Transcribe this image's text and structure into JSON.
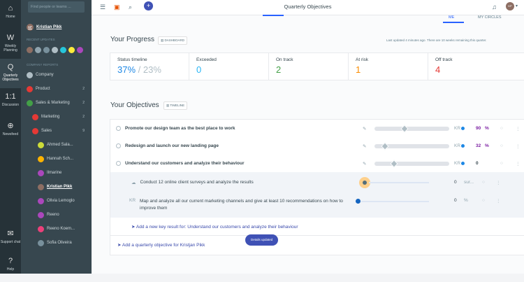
{
  "rail": [
    {
      "icon": "⌂",
      "label": "Home",
      "name": "home"
    },
    {
      "icon": "W",
      "label": "Weekly Planning",
      "name": "weekly-planning"
    },
    {
      "icon": "Q",
      "label": "Quarterly Objectives",
      "name": "quarterly-objectives"
    },
    {
      "icon": "1:1",
      "label": "Discussion",
      "name": "discussion"
    },
    {
      "icon": "⊕",
      "label": "Newsfeed",
      "name": "newsfeed"
    },
    {
      "icon": "✉",
      "label": "Support chat",
      "name": "support-chat"
    },
    {
      "icon": "?",
      "label": "Help",
      "name": "help"
    }
  ],
  "sidebar": {
    "search_placeholder": "Find people or teams ...",
    "user": {
      "initials": "KP",
      "name": "Kristian Pikk"
    },
    "recent_label": "RECENT UPDATES",
    "company_label": "COMPANY REPORTS",
    "tree": [
      {
        "label": "Company",
        "count": "",
        "indent": 8,
        "color": "#b0bec5"
      },
      {
        "label": "Product",
        "count": "2",
        "indent": 8,
        "color": "#e53935"
      },
      {
        "label": "Sales & Marketing",
        "count": "2",
        "indent": 8,
        "color": "#43a047"
      },
      {
        "label": "Marketing",
        "count": "2",
        "indent": 16,
        "color": "#e53935"
      },
      {
        "label": "Sales",
        "count": "9",
        "indent": 16,
        "color": "#e53935"
      },
      {
        "label": "Ahmed Sala...",
        "count": "",
        "indent": 24,
        "color": "#cddc39"
      },
      {
        "label": "Hannah Sch...",
        "count": "",
        "indent": 24,
        "color": "#ffb300"
      },
      {
        "label": "Ilmarine",
        "count": "",
        "indent": 24,
        "color": "#ab47bc"
      },
      {
        "label": "Kristian Pikk",
        "count": "",
        "indent": 24,
        "color": "#8d6e63",
        "selected": true
      },
      {
        "label": "Olivia Lemoglo",
        "count": "",
        "indent": 24,
        "color": "#ab47bc"
      },
      {
        "label": "Reeno",
        "count": "",
        "indent": 24,
        "color": "#ab47bc"
      },
      {
        "label": "Reeno Koem...",
        "count": "",
        "indent": 24,
        "color": "#ec407a"
      },
      {
        "label": "Sofia Oliveira",
        "count": "",
        "indent": 24,
        "color": "#78909c"
      }
    ]
  },
  "topbar": {
    "title": "Quarterly Objectives",
    "me_tab": "ME",
    "circles_tab": "MY CIRCLES",
    "avatar": "KP"
  },
  "progress": {
    "title": "Your Progress",
    "dashboard": "DASHBOARD",
    "updated": "Last updated 4 minutes ago. There are 10 weeks remaining this quarter.",
    "status_label": "Status timeline",
    "status_value": "37%",
    "status_sep": " / ",
    "status_target": "23%",
    "exceeded_label": "Exceeded",
    "exceeded_value": "0",
    "ontrack_label": "On track",
    "ontrack_value": "2",
    "atrisk_label": "At risk",
    "atrisk_value": "1",
    "offtrack_label": "Off track",
    "offtrack_value": "4"
  },
  "objectives": {
    "title": "Your Objectives",
    "timeline": "TIMELINE",
    "rows": [
      {
        "text": "Promote our design team as the best place to work",
        "progress": 0.9,
        "pct": "90",
        "unit": "%",
        "color": "#7b1fa2",
        "pct_color": "#7b1fa2"
      },
      {
        "text": "Redesign and launch our new landing page",
        "progress": 0.32,
        "pct": "32",
        "unit": "%",
        "color": "#7b1fa2",
        "pct_color": "#7b1fa2"
      },
      {
        "text": "Understand our customers and analyze their behaviour",
        "progress": 0,
        "pct": "0",
        "unit": "",
        "color": "#7b1fa2",
        "pct_color": "#37474f"
      }
    ],
    "kr_tag": "KR",
    "key_results": [
      {
        "text": "Conduct 12 online client surveys and analyze the results",
        "value": "0",
        "unit": "sur..."
      },
      {
        "text": "Map and analyze all our current marketing channels and give at least 10 recommendations on how to improve them",
        "prefix": "KR",
        "value": "0",
        "unit": "%"
      }
    ],
    "add_kr": "Add a new key result for: Understand our customers and analyze their behaviour",
    "add_objective": "Add a quarterly objective for Kristjan Pikk",
    "toast": "Details updated"
  }
}
